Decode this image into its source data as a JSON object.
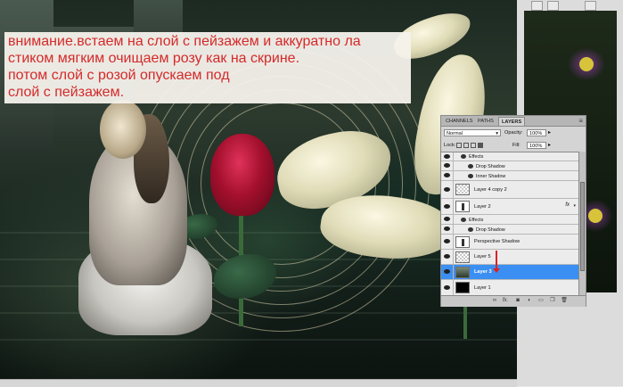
{
  "note": {
    "lines": [
      "внимание.встаем на слой с пейзажем и аккуратно ла",
      "стиком мягким очищаем розу как на скрине.",
      "потом слой с розой опускаем под",
      "слой с пейзажем."
    ]
  },
  "layers_panel": {
    "tabs": [
      "CHANNELS",
      "PATHS",
      "LAYERS"
    ],
    "active_tab": "LAYERS",
    "blend_mode": "Normal",
    "opacity_label": "Opacity:",
    "opacity_value": "100%",
    "lock_label": "Lock:",
    "fill_label": "Fill:",
    "fill_value": "100%",
    "rows": {
      "effects_top": "Effects",
      "drop_shadow_top": "Drop Shadow",
      "inner_shadow": "Inner Shadow",
      "layer4copy2": "Layer 4 copy 2",
      "layer2": "Layer 2",
      "layer2_fx": "fx",
      "effects_l2": "Effects",
      "drop_shadow_l2": "Drop Shadow",
      "perspective_shadow": "Perspective Shadow",
      "layer5": "Layer 5",
      "layer3": "Layer 3",
      "layer1": "Layer 1"
    },
    "selected_layer": "Layer 3",
    "bottom_icons": [
      "link-icon",
      "fx-icon",
      "mask-icon",
      "adjustment-icon",
      "group-icon",
      "new-layer-icon",
      "trash-icon"
    ],
    "bottom_fx_label": "fx."
  },
  "colors": {
    "note_text": "#d42a2a",
    "selection": "#3b8ff2",
    "rose": "#a4102e"
  }
}
